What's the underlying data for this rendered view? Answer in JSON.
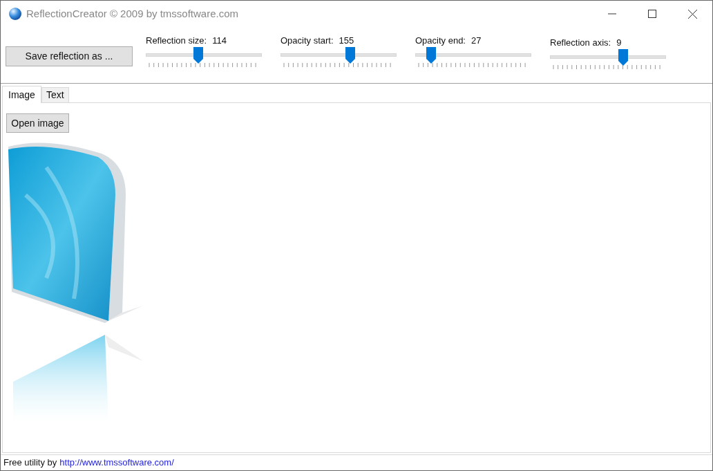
{
  "window": {
    "title": "ReflectionCreator © 2009 by tmssoftware.com"
  },
  "toolbar": {
    "save_button": "Save reflection as ...",
    "sliders": [
      {
        "label": "Reflection size:",
        "value": "114",
        "level": 0.45
      },
      {
        "label": "Opacity start:",
        "value": "155",
        "level": 0.6
      },
      {
        "label": "Opacity end:",
        "value": "27",
        "level": 0.13
      },
      {
        "label": "Reflection axis:",
        "value": "9",
        "level": 0.63
      }
    ]
  },
  "tabs": [
    {
      "label": "Image",
      "selected": true
    },
    {
      "label": "Text",
      "selected": false
    }
  ],
  "image_tab": {
    "open_button": "Open image"
  },
  "status_bar": {
    "text": "Free utility by",
    "link": "http://www.tmssoftware.com/"
  }
}
